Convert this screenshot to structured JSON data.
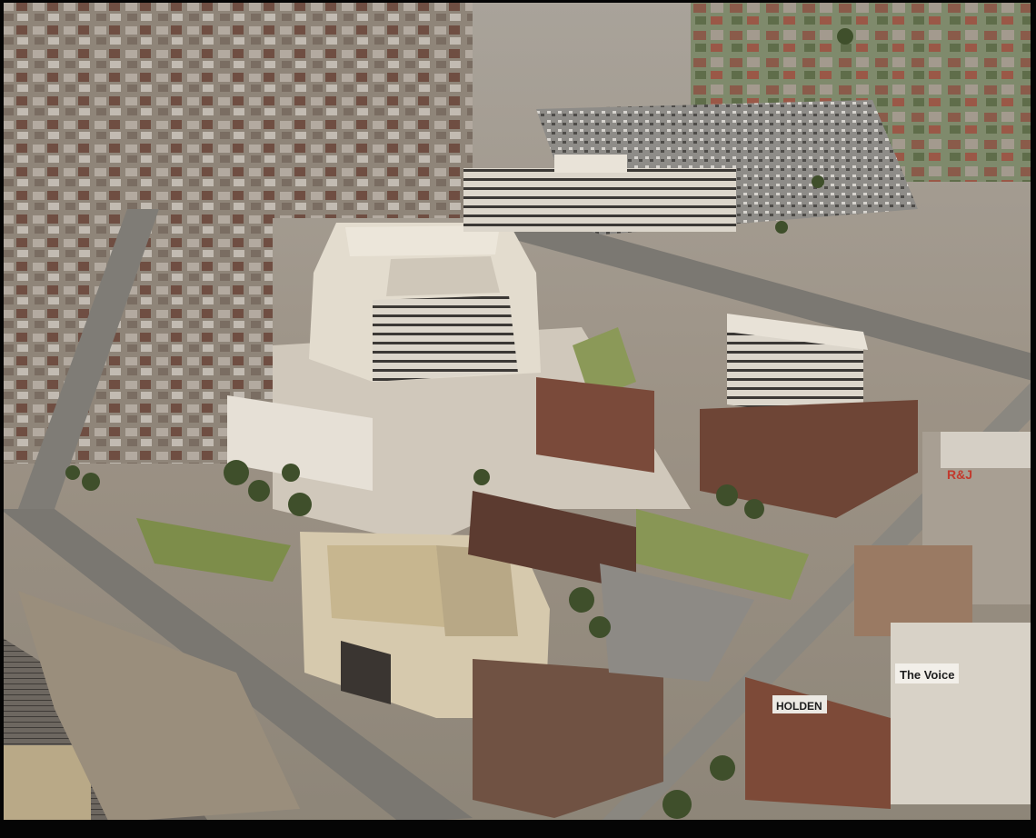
{
  "photo": {
    "signs": {
      "rnj": "R&J",
      "holden": "HOLDEN",
      "voice": "The Voice"
    }
  }
}
